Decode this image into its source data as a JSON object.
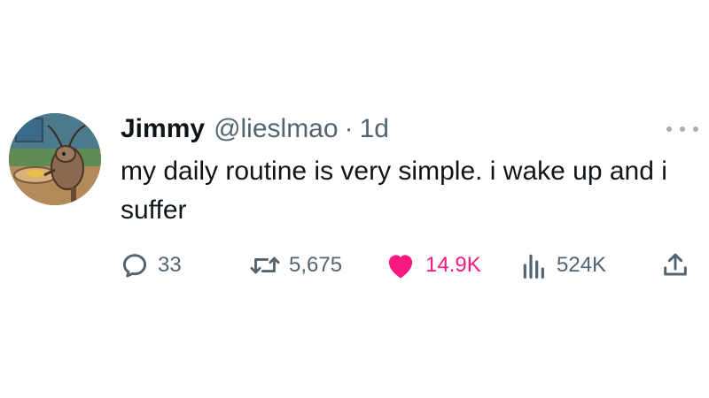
{
  "tweet": {
    "display_name": "Jimmy",
    "handle": "@lieslmao",
    "separator": "·",
    "time": "1d",
    "text": "my daily routine is very simple. i wake up and i suffer"
  },
  "actions": {
    "replies": "33",
    "retweets": "5,675",
    "likes": "14.9K",
    "views": "524K"
  },
  "icons": {
    "reply": "reply-icon",
    "retweet": "retweet-icon",
    "like": "heart-icon",
    "views": "views-icon",
    "share": "share-icon",
    "more": "more-icon"
  },
  "colors": {
    "text": "#0f1419",
    "muted": "#536471",
    "like_active": "#f91880"
  }
}
